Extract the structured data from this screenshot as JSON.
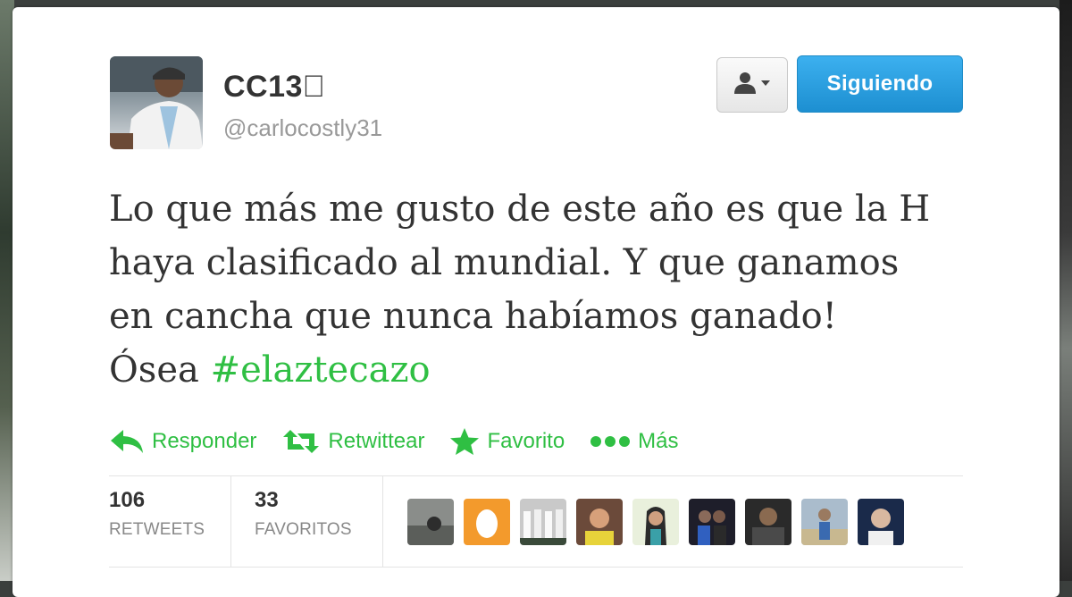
{
  "tweet": {
    "display_name": "CC13⃣",
    "username": "@carlocostly31",
    "follow_label": "Siguiendo",
    "text_lines": [
      "Lo que más me gusto de este año es que la H",
      "haya clasificado al mundial. Y que ganamos",
      "en cancha que nunca habíamos ganado!"
    ],
    "last_line_prefix": "Ósea ",
    "hashtag": "#elaztecazo"
  },
  "actions": {
    "reply": "Responder",
    "retweet": "Retwittear",
    "favorite": "Favorito",
    "more": "Más"
  },
  "stats": {
    "retweets_count": "106",
    "retweets_label": "RETWEETS",
    "favorites_count": "33",
    "favorites_label": "FAVORITOS"
  },
  "colors": {
    "accent_green": "#2fbf43",
    "follow_blue": "#1d8fd1",
    "text": "#333333",
    "muted": "#999999"
  },
  "icons": [
    "user-dropdown-icon",
    "reply-icon",
    "retweet-icon",
    "star-icon",
    "more-dots-icon"
  ]
}
